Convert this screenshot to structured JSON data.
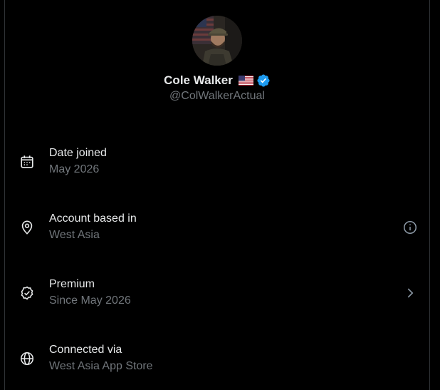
{
  "profile": {
    "name": "Cole Walker",
    "handle": "@ColWalkerActual",
    "flag_icon": "us-flag-icon",
    "verified_icon": "verified-badge-icon",
    "verified_color": "#1d9bf0"
  },
  "details": [
    {
      "icon": "calendar-icon",
      "title": "Date joined",
      "subtitle": "May 2026",
      "trailing": ""
    },
    {
      "icon": "location-pin-icon",
      "title": "Account based in",
      "subtitle": "West Asia",
      "trailing": "info-icon"
    },
    {
      "icon": "premium-badge-icon",
      "title": "Premium",
      "subtitle": "Since May 2026",
      "trailing": "chevron-right-icon"
    },
    {
      "icon": "globe-icon",
      "title": "Connected via",
      "subtitle": "West Asia App Store",
      "trailing": ""
    }
  ],
  "colors": {
    "background": "#000000",
    "text_primary": "#e7e9ea",
    "text_secondary": "#71767b"
  }
}
